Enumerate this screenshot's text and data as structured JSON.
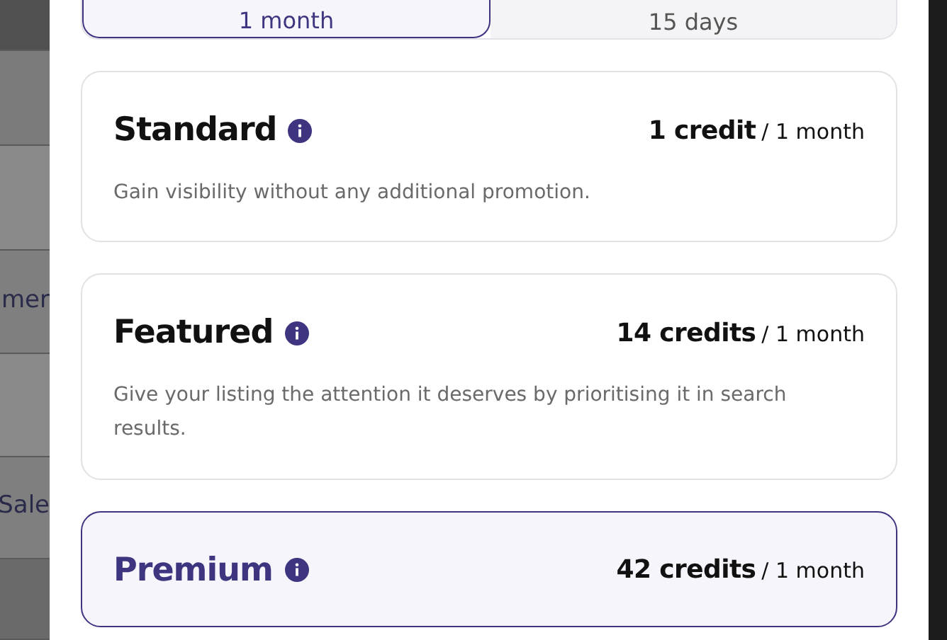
{
  "background": {
    "fragments": [
      "mer",
      "Sale"
    ]
  },
  "period_tabs": [
    {
      "label": "1 month",
      "selected": true
    },
    {
      "label": "15 days",
      "selected": false
    }
  ],
  "plans": [
    {
      "name": "Standard",
      "price": "1 credit",
      "period": "/ 1 month",
      "description": "Gain visibility without any additional promotion.",
      "selected": false
    },
    {
      "name": "Featured",
      "price": "14 credits",
      "period": "/ 1 month",
      "description": "Give your listing the attention it deserves by prioritising it in search results.",
      "selected": false
    },
    {
      "name": "Premium",
      "price": "42 credits",
      "period": "/ 1 month",
      "selected": true
    }
  ]
}
